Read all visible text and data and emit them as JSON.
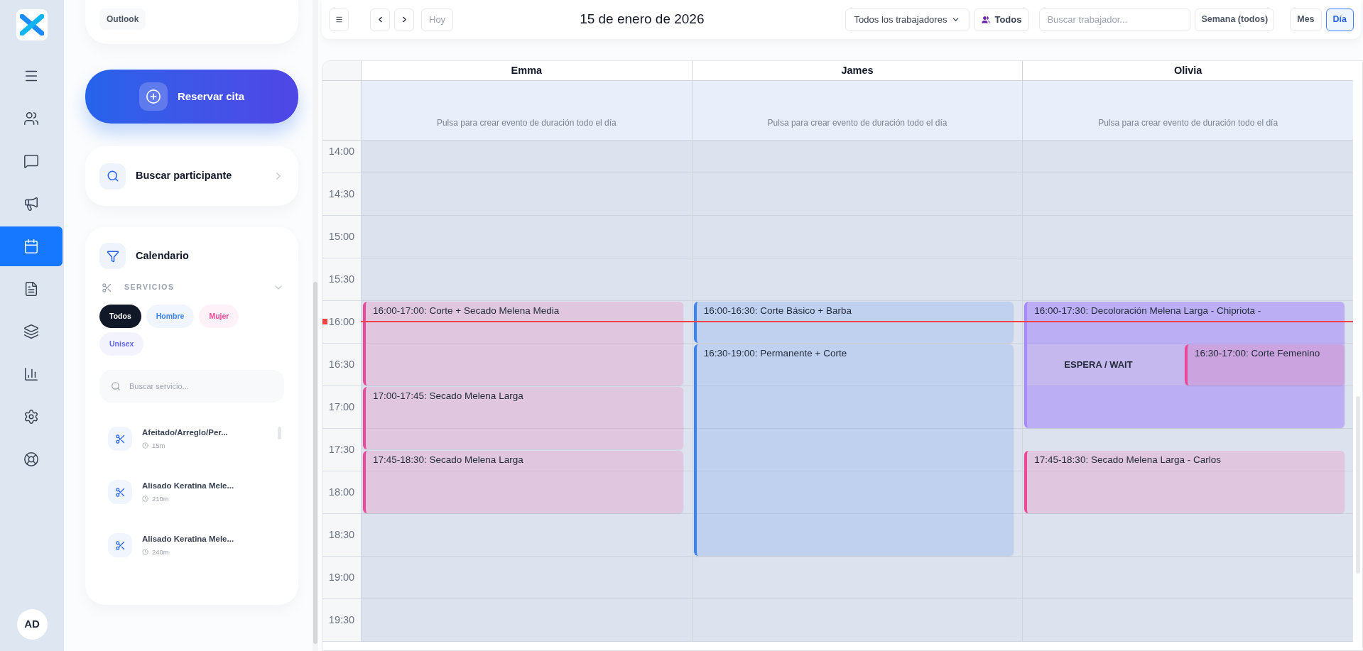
{
  "nav_rail": {
    "items": [
      {
        "kind": "menu",
        "selected": false
      },
      {
        "kind": "users",
        "selected": false
      },
      {
        "kind": "chat",
        "selected": false
      },
      {
        "kind": "megaphone",
        "selected": false
      },
      {
        "kind": "calendar",
        "selected": true
      },
      {
        "kind": "document",
        "selected": false
      },
      {
        "kind": "layers",
        "selected": false
      },
      {
        "kind": "chart",
        "selected": false
      },
      {
        "kind": "settings",
        "selected": false
      },
      {
        "kind": "support",
        "selected": false
      }
    ],
    "avatar": "AD"
  },
  "sidebar": {
    "outlook_chip": "Outlook",
    "book_button": "Reservar cita",
    "participant_search": "Buscar participante",
    "calendar_title": "Calendario",
    "services_label": "SERVICIOS",
    "filters": [
      {
        "label": "Todos",
        "selected": true,
        "color": "#111827"
      },
      {
        "label": "Hombre",
        "selected": false,
        "color": "#3b82f6"
      },
      {
        "label": "Mujer",
        "selected": false,
        "color": "#ec4899"
      },
      {
        "label": "Unisex",
        "selected": false,
        "color": "#6366f1"
      }
    ],
    "service_search": {
      "placeholder": "Buscar servicio..."
    },
    "services": [
      {
        "name": "Afeitado/Arreglo/Per...",
        "duration": "15m"
      },
      {
        "name": "Alisado Keratina Mele...",
        "duration": "210m"
      },
      {
        "name": "Alisado Keratina Mele...",
        "duration": "240m"
      }
    ]
  },
  "toolbar": {
    "today": "Hoy",
    "date": "15 de enero de 2026",
    "worker_select": "Todos los trabajadores",
    "all_button": "Todos",
    "worker_search": {
      "placeholder": "Buscar trabajador..."
    },
    "week_button": "Semana (todos)",
    "views": [
      {
        "label": "Mes",
        "selected": false
      },
      {
        "label": "Día",
        "selected": true
      }
    ]
  },
  "calendar": {
    "times": [
      "14:00",
      "14:30",
      "15:00",
      "15:30",
      "16:00",
      "16:30",
      "17:00",
      "17:30",
      "18:00",
      "18:30",
      "19:00",
      "19:30"
    ],
    "columns": [
      {
        "name": "Emma",
        "all_day_hint": "Pulsa para crear evento de duración todo el día",
        "events": [
          {
            "kind": "appointment",
            "text": "16:00-17:00: Corte + Secado Melena Media",
            "color": "#ec4899"
          },
          {
            "kind": "appointment",
            "text": "17:00-17:45: Secado Melena Larga",
            "color": "#ec4899"
          },
          {
            "kind": "appointment",
            "text": "17:45-18:30: Secado Melena Larga",
            "color": "#ec4899"
          }
        ]
      },
      {
        "name": "James",
        "all_day_hint": "Pulsa para crear evento de duración todo el día",
        "events": [
          {
            "kind": "appointment",
            "text": "16:00-16:30: Corte Básico + Barba",
            "color": "#3b82f6"
          },
          {
            "kind": "appointment",
            "text": "16:30-19:00: Permanente + Corte",
            "color": "#3b82f6"
          }
        ]
      },
      {
        "name": "Olivia",
        "all_day_hint": "Pulsa para crear evento de duración todo el día",
        "events": [
          {
            "kind": "block",
            "text": "16:00-17:30: Decoloración Melena Larga - Chipriota -",
            "color": "#a78bfa",
            "wait_label": "ESPERA / WAIT",
            "nested": [
              {
                "kind": "appointment",
                "text": "16:30-17:00: Corte Femenino",
                "color": "#ec4899"
              }
            ]
          },
          {
            "kind": "appointment",
            "text": "17:45-18:30: Secado Melena Larga - Carlos",
            "color": "#ec4899"
          }
        ]
      }
    ]
  }
}
